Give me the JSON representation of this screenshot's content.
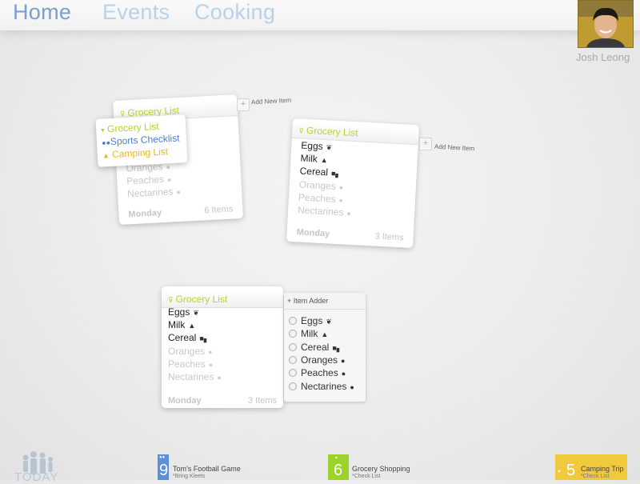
{
  "nav": {
    "tabs": [
      {
        "label": "Home"
      },
      {
        "label": "Events"
      },
      {
        "label": "Cooking"
      }
    ]
  },
  "user": {
    "name": "Josh Leong"
  },
  "add_new_item_label": "Add New Item",
  "dropdown": {
    "items": [
      {
        "label": "Grocery List",
        "color": "#b5d32d"
      },
      {
        "label": "Sports Checklist",
        "color": "#4a7fd4"
      },
      {
        "label": "Camping List",
        "color": "#e7b82e"
      }
    ]
  },
  "card1": {
    "title": "Grocery List",
    "items": [
      {
        "label": "Oranges",
        "state": "faint"
      },
      {
        "label": "Peaches",
        "state": "faint"
      },
      {
        "label": "Nectarines",
        "state": "faint"
      }
    ],
    "day": "Monday",
    "count": "6 Items"
  },
  "card2": {
    "title": "Grocery List",
    "items": [
      {
        "label": "Eggs",
        "state": "dark"
      },
      {
        "label": "Milk",
        "state": "dark"
      },
      {
        "label": "Cereal",
        "state": "dark"
      },
      {
        "label": "Oranges",
        "state": "faint"
      },
      {
        "label": "Peaches",
        "state": "faint"
      },
      {
        "label": "Nectarines",
        "state": "faint"
      }
    ],
    "day": "Monday",
    "count": "3 Items"
  },
  "card3": {
    "title": "Grocery List",
    "items": [
      {
        "label": "Eggs",
        "state": "dark"
      },
      {
        "label": "Milk",
        "state": "dark"
      },
      {
        "label": "Cereal",
        "state": "dark"
      },
      {
        "label": "Oranges",
        "state": "faint"
      },
      {
        "label": "Peaches",
        "state": "faint"
      },
      {
        "label": "Nectarines",
        "state": "faint"
      }
    ],
    "day": "Monday",
    "count": "3 Items"
  },
  "item_adder": {
    "title": "Item Adder",
    "items": [
      {
        "label": "Eggs"
      },
      {
        "label": "Milk"
      },
      {
        "label": "Cereal"
      },
      {
        "label": "Oranges"
      },
      {
        "label": "Peaches"
      },
      {
        "label": "Nectarines"
      }
    ]
  },
  "bottom": {
    "today": "TODAY",
    "events": [
      {
        "day": "9",
        "title": "Tom's Football Game",
        "sub": "*Bring Kleets",
        "color": "#5b8fd6"
      },
      {
        "day": "6",
        "title": "Grocery Shopping",
        "sub": "*Check List",
        "color": "#9bd32b"
      },
      {
        "day": "5",
        "title": "Camping Trip",
        "sub": "*Check List",
        "color": "#f0c93d"
      }
    ]
  },
  "icons": {
    "eggs": "egg-icon",
    "milk": "milk-carton-icon",
    "cereal": "cereal-box-icon",
    "oranges": "orange-icon",
    "peaches": "peach-icon",
    "nectarines": "nectarine-icon"
  }
}
